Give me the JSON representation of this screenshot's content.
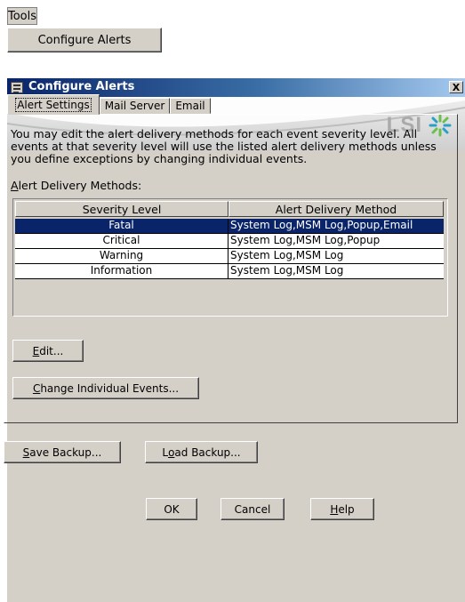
{
  "menu": {
    "tools_label": "Tools",
    "configure_alerts_label": "Configure Alerts"
  },
  "dialog": {
    "title": "Configure Alerts",
    "close_label": "X",
    "logo_text": "LSI",
    "tabs": [
      {
        "label": "Alert Settings",
        "active": true
      },
      {
        "label": "Mail Server",
        "active": false
      },
      {
        "label": "Email",
        "active": false
      }
    ],
    "description": "You may edit the alert delivery methods for each event severity level. All events at that severity level will use the listed alert delivery methods unless you define exceptions by changing individual events.",
    "methods_label_prefix": "A",
    "methods_label_rest": "lert Delivery Methods:",
    "table": {
      "headers": [
        "Severity Level",
        "Alert Delivery Method"
      ],
      "rows": [
        {
          "severity": "Fatal",
          "method": "System Log,MSM Log,Popup,Email",
          "selected": true
        },
        {
          "severity": "Critical",
          "method": "System Log,MSM Log,Popup",
          "selected": false
        },
        {
          "severity": "Warning",
          "method": "System Log,MSM Log",
          "selected": false
        },
        {
          "severity": "Information",
          "method": "System Log,MSM Log",
          "selected": false
        }
      ]
    },
    "buttons": {
      "edit": {
        "mn": "E",
        "rest": "dit..."
      },
      "change_events": {
        "mn": "C",
        "rest": "hange Individual Events..."
      },
      "save_backup": {
        "mn": "S",
        "rest": "ave Backup..."
      },
      "load_backup": {
        "pre": "L",
        "mn": "o",
        "rest": "ad Backup..."
      },
      "ok": "OK",
      "cancel": "Cancel",
      "help": {
        "mn": "H",
        "rest": "elp"
      }
    },
    "colors": {
      "selection": "#0a246a",
      "face": "#d4d0c8",
      "title_start": "#0a246a"
    }
  }
}
